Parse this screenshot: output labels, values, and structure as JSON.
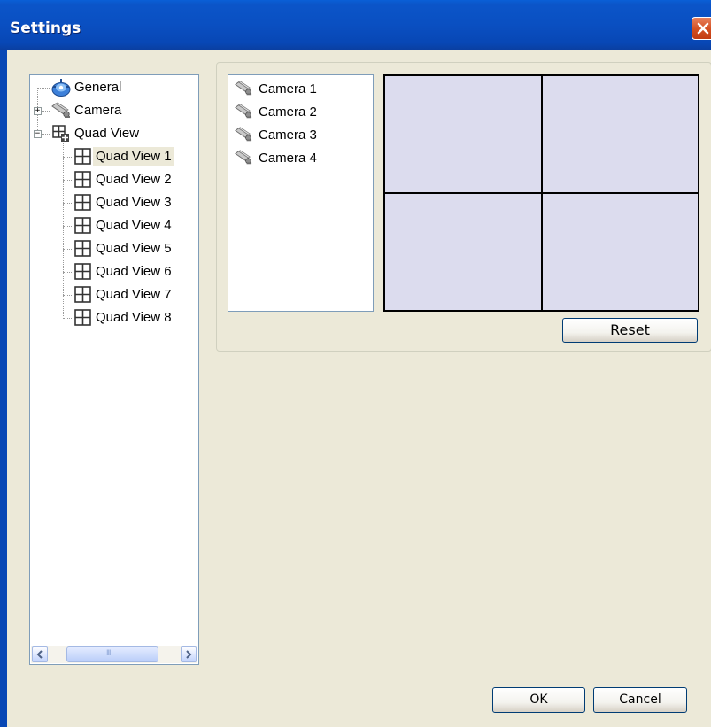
{
  "window": {
    "title": "Settings"
  },
  "tree": {
    "items": [
      {
        "label": "General",
        "icon": "gear-icon"
      },
      {
        "label": "Camera",
        "icon": "camera-icon",
        "expander": "+"
      },
      {
        "label": "Quad View",
        "icon": "quad-view-icon",
        "expander": "−"
      }
    ],
    "quad_views": [
      "Quad View 1",
      "Quad View 2",
      "Quad View 3",
      "Quad View 4",
      "Quad View 5",
      "Quad View 6",
      "Quad View 7",
      "Quad View 8"
    ],
    "selected": "Quad View 1",
    "scrollbar_thumb_grip": "III"
  },
  "cameras": [
    "Camera 1",
    "Camera 2",
    "Camera 3",
    "Camera 4"
  ],
  "quad_preview": {
    "fill_color": "#DCDCEE",
    "grid_color": "#000000"
  },
  "buttons": {
    "reset": "Reset",
    "ok": "OK",
    "cancel": "Cancel"
  }
}
